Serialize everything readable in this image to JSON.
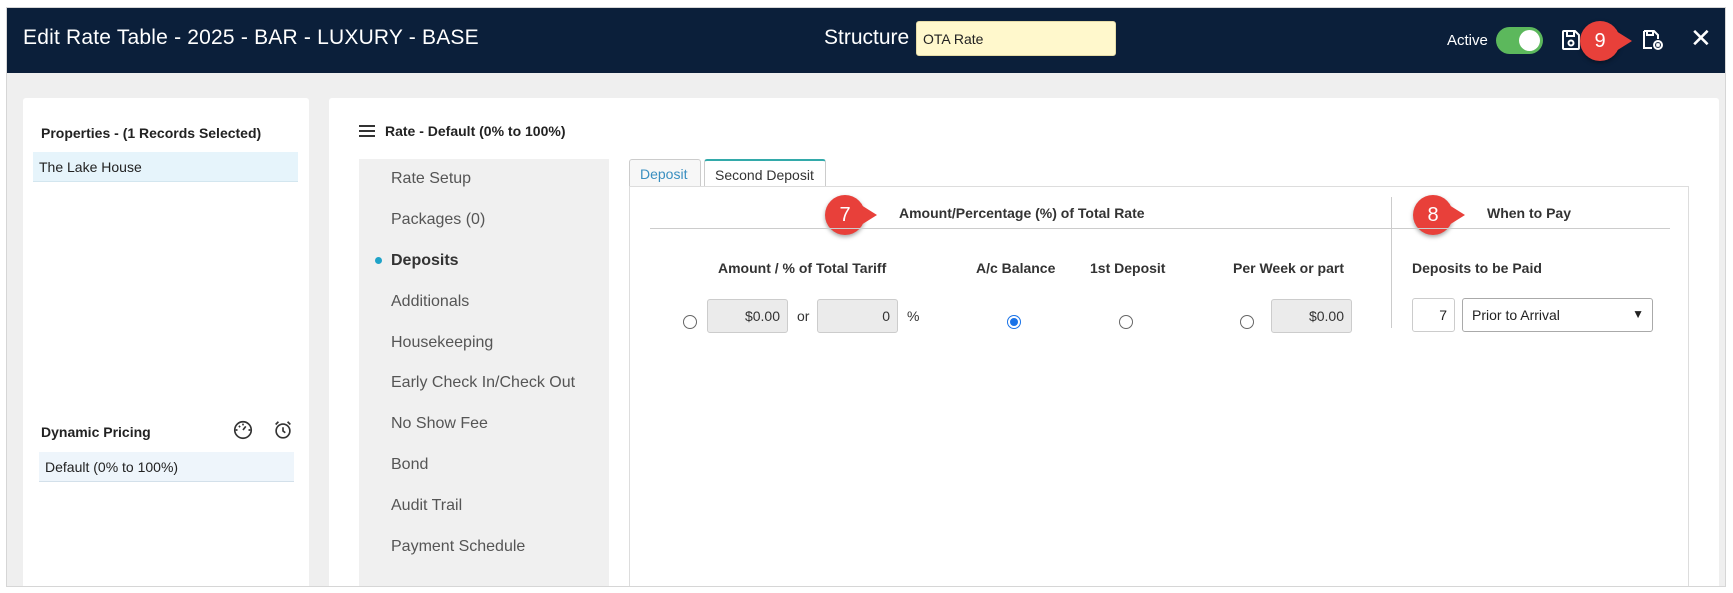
{
  "header": {
    "title": "Edit Rate Table - 2025 - BAR - LUXURY - BASE",
    "structure_label": "Structure",
    "structure_value": "OTA Rate",
    "active_label": "Active",
    "active_on": true
  },
  "callouts": {
    "seven": "7",
    "eight": "8",
    "nine": "9"
  },
  "properties": {
    "heading": "Properties - (1 Records Selected)",
    "items": [
      "The Lake House"
    ]
  },
  "dynamic_pricing": {
    "heading": "Dynamic Pricing",
    "items": [
      "Default (0% to 100%)"
    ]
  },
  "rate": {
    "heading": "Rate - Default (0% to 100%)"
  },
  "nav": {
    "items": [
      "Rate Setup",
      "Packages (0)",
      "Deposits",
      "Additionals",
      "Housekeeping",
      "Early Check In/Check Out",
      "No Show Fee",
      "Bond",
      "Audit Trail",
      "Payment Schedule"
    ],
    "active": "Deposits"
  },
  "tabs": [
    "Deposit",
    "Second Deposit"
  ],
  "deposit_section": {
    "title": "Amount/Percentage (%) of Total Rate",
    "col_amount": "Amount / % of Total Tariff",
    "col_balance": "A/c Balance",
    "col_first": "1st Deposit",
    "col_week": "Per Week or part",
    "amount_value": "$0.00",
    "or_text": "or",
    "percent_value": "0",
    "percent_sign": "%",
    "week_value": "$0.00",
    "selected": "A/c Balance"
  },
  "pay_section": {
    "title": "When to Pay",
    "col_deposits": "Deposits to be Paid",
    "days_value": "7",
    "when_value": "Prior to Arrival"
  },
  "colors": {
    "header_bg": "#0b1f3a",
    "toggle_on": "#5cb85c",
    "callout": "#e8403a",
    "structure_bg": "#fff8cc"
  }
}
